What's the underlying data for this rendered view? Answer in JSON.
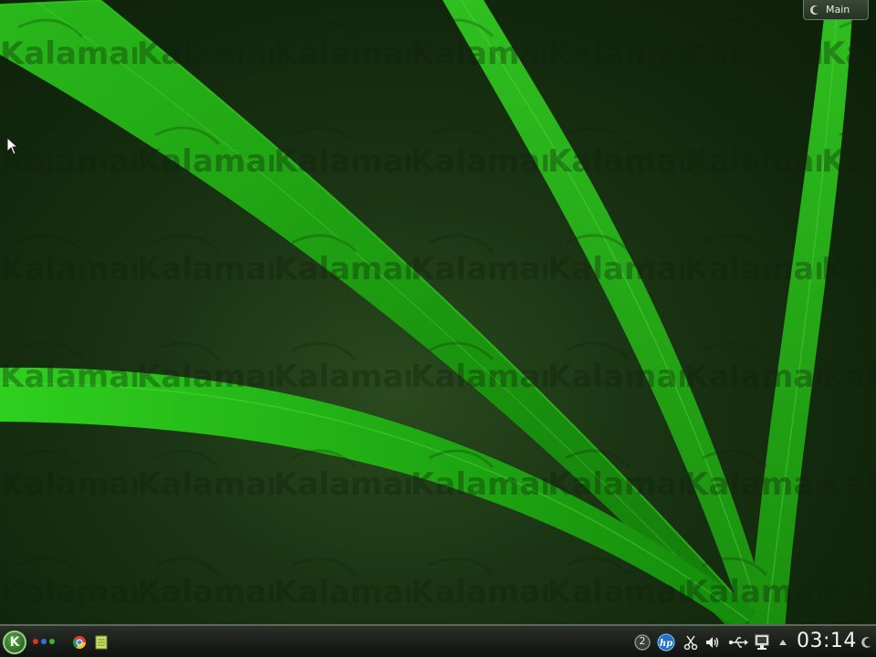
{
  "desktop": {
    "activity_label": "Main",
    "watermark_text": "Kalamar"
  },
  "taskbar": {
    "launcher_letter": "K",
    "notification_count": "2",
    "clock_time": "03:14"
  },
  "icons": {
    "launcher": "k-menu-icon",
    "pager": "virtual-desktop-pager-icon",
    "browser": "chrome-icon",
    "files": "file-manager-icon",
    "notifications": "notifications-icon",
    "printer": "hp-printer-icon",
    "clipboard": "scissors-icon",
    "volume": "volume-icon",
    "usb": "usb-icon",
    "network": "network-icon",
    "tray_expand": "arrow-up-icon",
    "dashboard": "dashboard-toolbox-icon"
  },
  "colors": {
    "leaf_green": "#1fa80f",
    "leaf_green_light": "#3fd12a",
    "background_dark": "#11270c"
  }
}
